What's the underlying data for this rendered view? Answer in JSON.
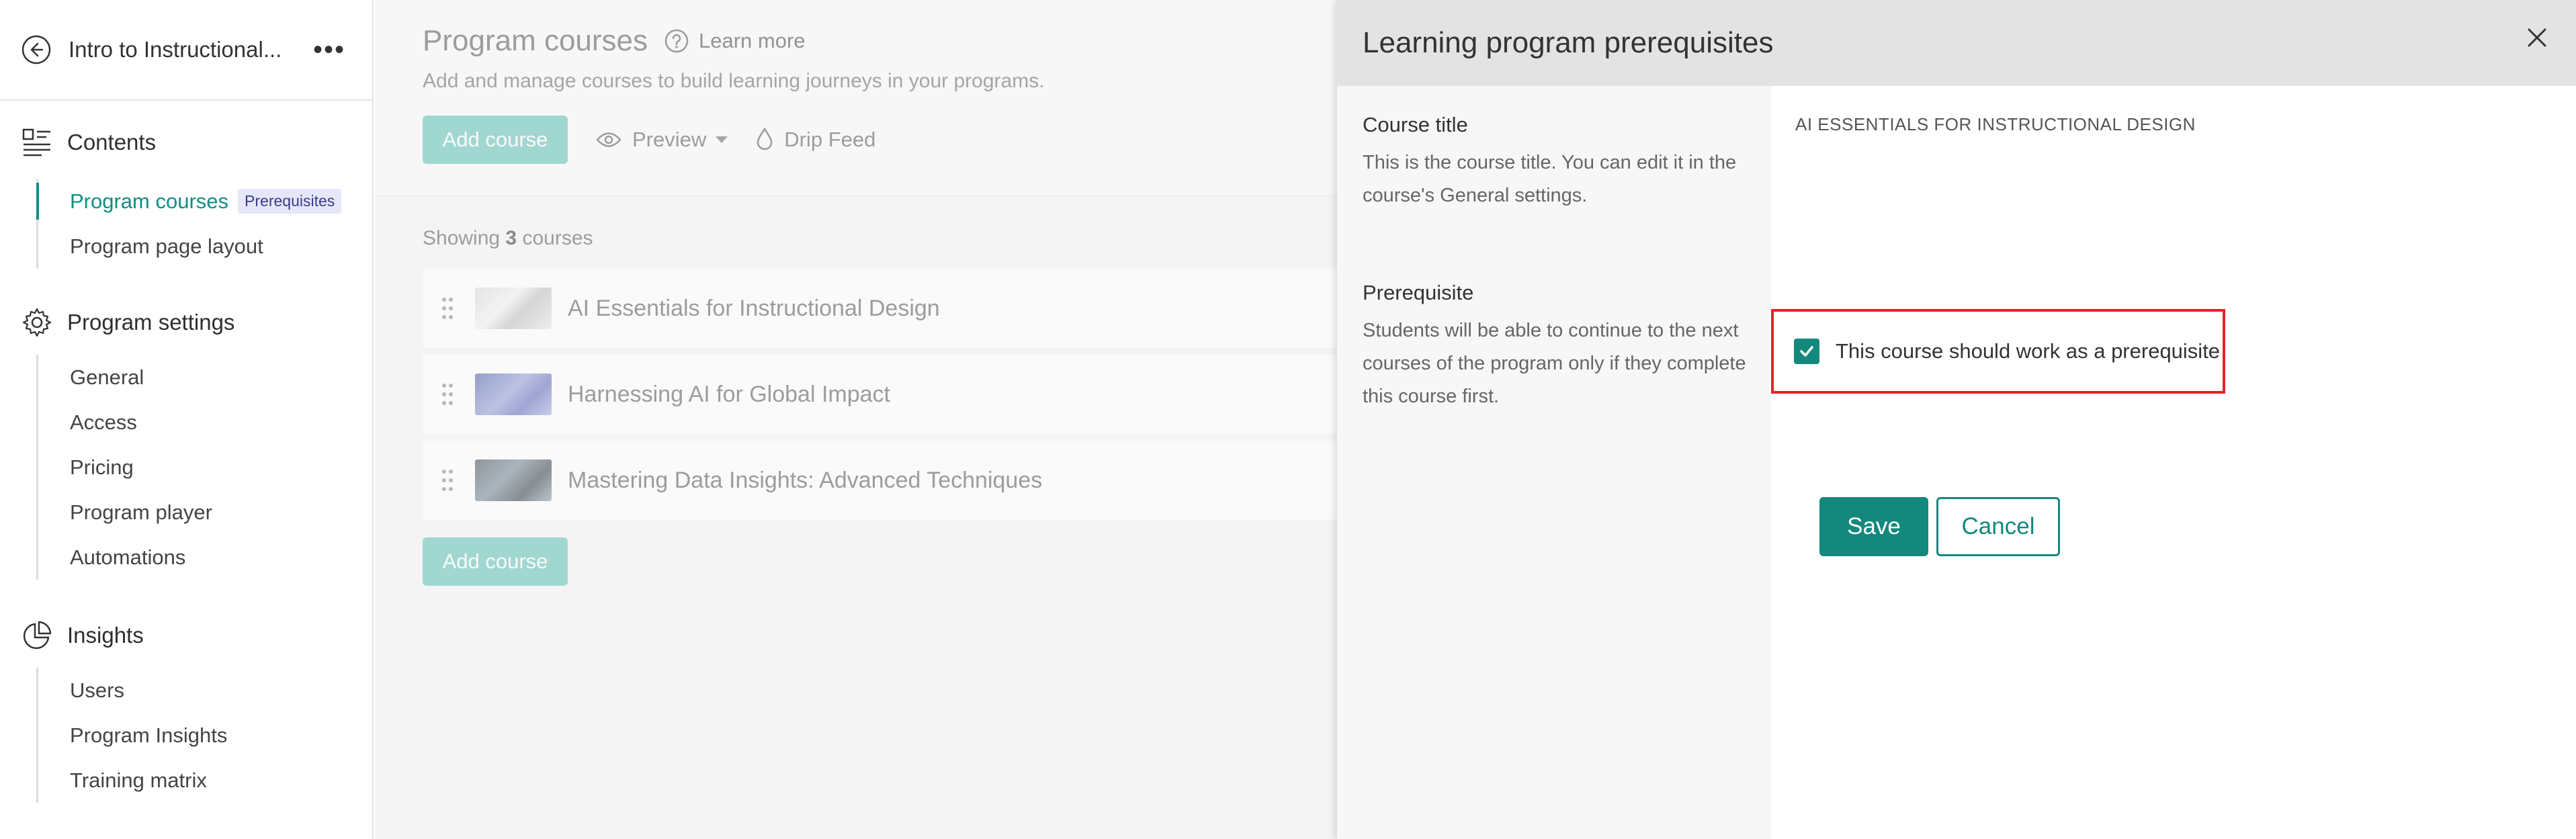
{
  "sidebar": {
    "title": "Intro to Instructional...",
    "sections": [
      {
        "label": "Contents",
        "items": [
          {
            "label": "Program courses",
            "badge": "Prerequisites"
          },
          {
            "label": "Program page layout"
          }
        ]
      },
      {
        "label": "Program settings",
        "items": [
          {
            "label": "General"
          },
          {
            "label": "Access"
          },
          {
            "label": "Pricing"
          },
          {
            "label": "Program player"
          },
          {
            "label": "Automations"
          }
        ]
      },
      {
        "label": "Insights",
        "items": [
          {
            "label": "Users"
          },
          {
            "label": "Program Insights"
          },
          {
            "label": "Training matrix"
          }
        ]
      }
    ]
  },
  "main": {
    "title": "Program courses",
    "learn_more": "Learn more",
    "subtitle": "Add and manage courses to build learning journeys in your programs.",
    "add_course": "Add course",
    "preview": "Preview",
    "drip_feed": "Drip Feed",
    "showing_prefix": "Showing",
    "showing_count": "3",
    "showing_suffix": "courses",
    "courses": [
      {
        "name": "AI Essentials for Instructional Design"
      },
      {
        "name": "Harnessing AI for Global Impact"
      },
      {
        "name": "Mastering Data Insights: Advanced Techniques"
      }
    ]
  },
  "panel": {
    "title": "Learning program prerequisites",
    "course_title_label": "Course title",
    "course_title_desc": "This is the course title. You can edit it in the course's General settings.",
    "course_title_value": "AI ESSENTIALS FOR INSTRUCTIONAL DESIGN",
    "prereq_label": "Prerequisite",
    "prereq_desc": "Students will be able to continue to the next courses of the program only if they complete this course first.",
    "checkbox_label": "This course should work as a prerequisite",
    "checkbox_checked": true,
    "save": "Save",
    "cancel": "Cancel"
  },
  "colors": {
    "accent": "#13897d",
    "highlight": "#e8202a",
    "badge_bg": "#e6e7f8"
  }
}
